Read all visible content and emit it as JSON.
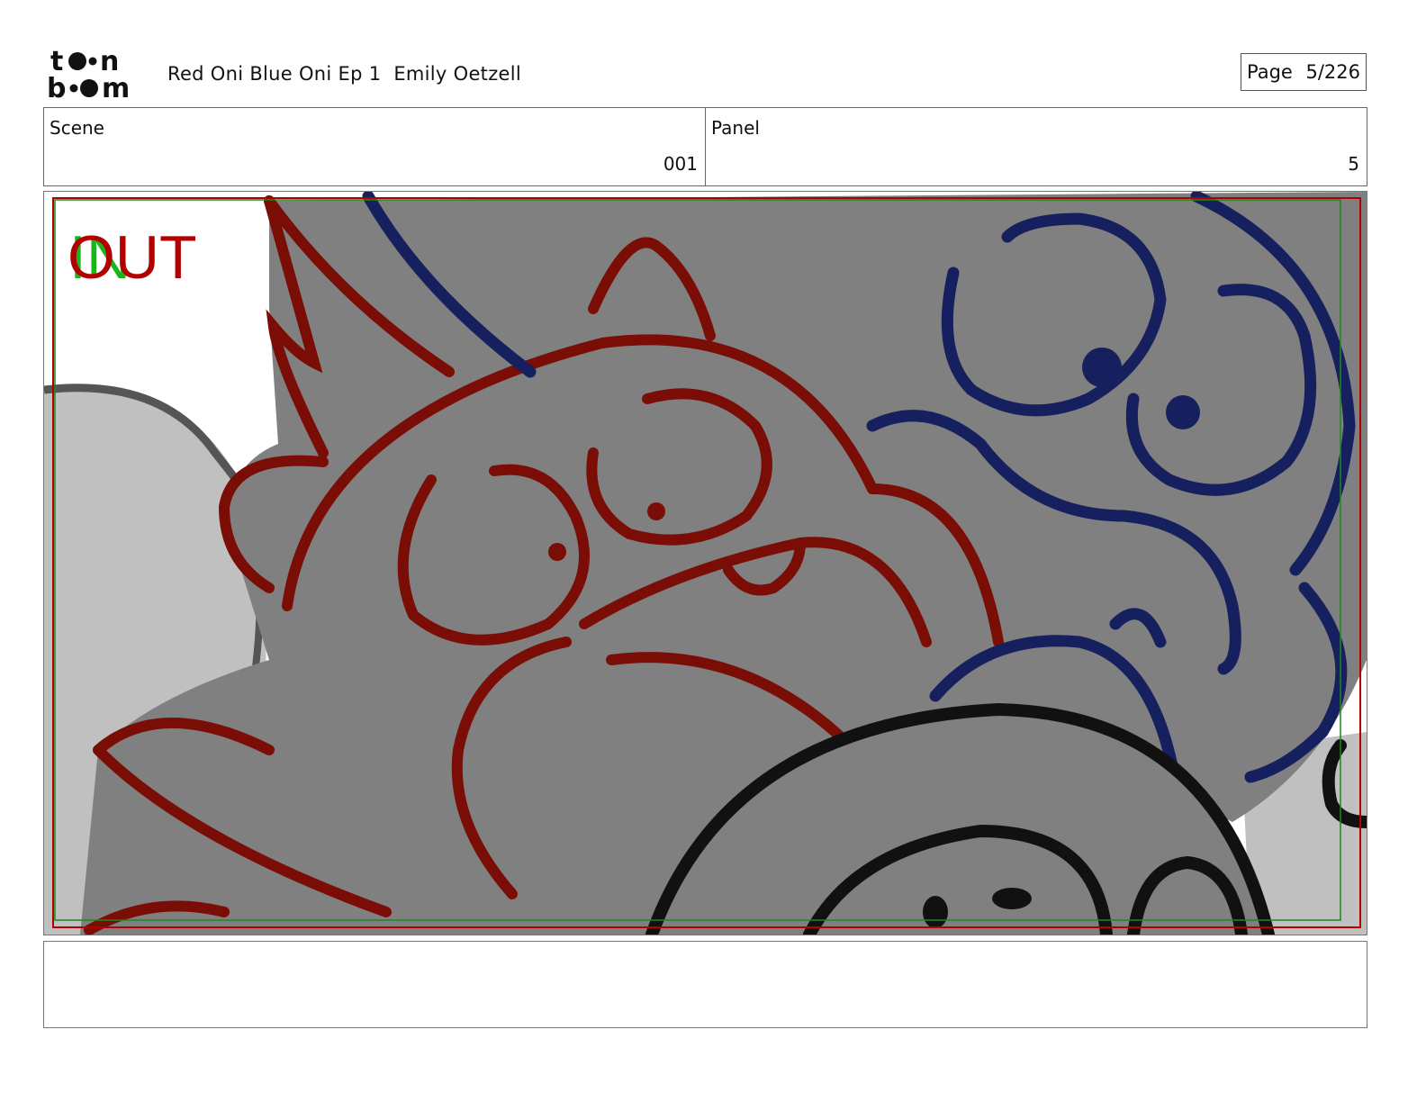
{
  "header": {
    "logo_text": "toon boom",
    "title": "Red Oni Blue Oni Ep 1",
    "author": "Emily Oetzell",
    "page_label": "Page",
    "page_value": "5/226"
  },
  "info": {
    "scene_label": "Scene",
    "scene_value": "001",
    "panel_label": "Panel",
    "panel_value": "5"
  },
  "panel": {
    "in_marker": "IN",
    "out_marker": "OUT",
    "colors": {
      "red_oni": "#7a0d05",
      "blue_oni": "#16205e",
      "body_fill": "#808080",
      "bg_fill": "#c0c0c0",
      "in_green": "#1cb41c",
      "out_red": "#b00000"
    }
  },
  "notes": {
    "text": ""
  }
}
